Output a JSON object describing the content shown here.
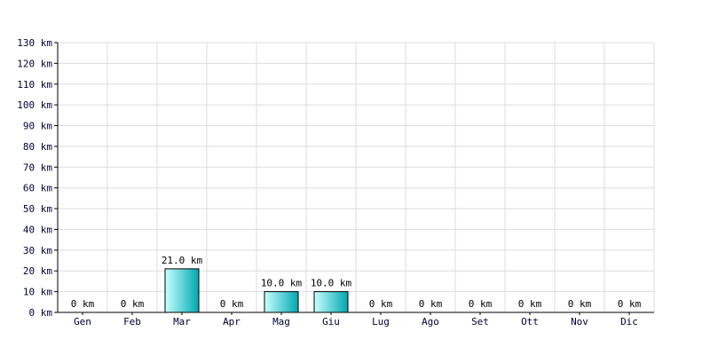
{
  "chart_data": {
    "type": "bar",
    "title": "",
    "xlabel": "",
    "ylabel": "",
    "categories": [
      "Gen",
      "Feb",
      "Mar",
      "Apr",
      "Mag",
      "Giu",
      "Lug",
      "Ago",
      "Set",
      "Ott",
      "Nov",
      "Dic"
    ],
    "values": [
      0,
      0,
      21.0,
      0,
      10.0,
      10.0,
      0,
      0,
      0,
      0,
      0,
      0
    ],
    "value_labels": [
      "0 km",
      "0 km",
      "21.0 km",
      "0 km",
      "10.0 km",
      "10.0 km",
      "0 km",
      "0 km",
      "0 km",
      "0 km",
      "0 km",
      "0 km"
    ],
    "ylim": [
      0,
      130
    ],
    "y_ticks": [
      0,
      10,
      20,
      30,
      40,
      50,
      60,
      70,
      80,
      90,
      100,
      110,
      120,
      130
    ],
    "y_tick_labels": [
      "0 km",
      "10 km",
      "20 km",
      "30 km",
      "40 km",
      "50 km",
      "60 km",
      "70 km",
      "80 km",
      "90 km",
      "100 km",
      "110 km",
      "120 km",
      "130 km"
    ],
    "grid": true,
    "colors": {
      "bar_light": "#c8ffff",
      "bar_dark": "#00a8b0",
      "bar_stroke": "#000000",
      "grid": "#dddddd",
      "axis": "#000000"
    }
  }
}
